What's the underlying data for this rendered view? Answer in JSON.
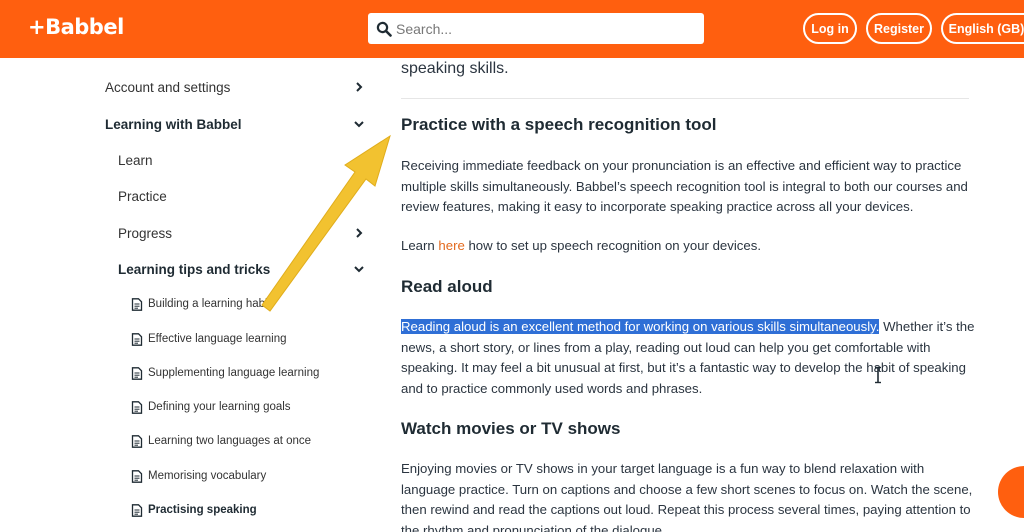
{
  "header": {
    "logo": "+Babbel",
    "search_placeholder": "Search...",
    "login_label": "Log in",
    "register_label": "Register",
    "language_label": "English (GB)"
  },
  "sidebar": {
    "items": [
      {
        "label": "Account and settings",
        "chevron": "right"
      },
      {
        "label": "Learning with Babbel",
        "chevron": "down"
      },
      {
        "label": "Learn",
        "chevron": ""
      },
      {
        "label": "Practice",
        "chevron": ""
      },
      {
        "label": "Progress",
        "chevron": "right"
      },
      {
        "label": "Learning tips and tricks",
        "chevron": "down"
      }
    ],
    "subitems": [
      "Building a learning habit",
      "Effective language learning",
      "Supplementing language learning",
      "Defining your learning goals",
      "Learning two languages at once",
      "Memorising vocabulary",
      "Practising speaking"
    ]
  },
  "content": {
    "intro_fragment": "speaking skills.",
    "sections": [
      {
        "heading": "Practice with a speech recognition tool",
        "paragraph": "Receiving immediate feedback on your pronunciation is an effective and efficient way to practice multiple skills simultaneously. Babbel’s speech recognition tool is integral to both our courses and review features, making it easy to incorporate speaking practice across all your devices.",
        "learn_prefix": "Learn ",
        "learn_link": "here",
        "learn_suffix": " how to set up speech recognition on your devices."
      },
      {
        "heading": "Read aloud",
        "highlighted": "Reading aloud is an excellent method for working on various skills simultaneously.",
        "paragraph": " Whether it’s the news, a short story, or lines from a play, reading out loud can help you get comfortable with speaking. It may feel a bit unusual at first, but it’s a fantastic way to develop the habit of speaking and to practice commonly used words and phrases."
      },
      {
        "heading": "Watch movies or TV shows",
        "paragraph": "Enjoying movies or TV shows in your target language is a fun way to blend relaxation with language practice. Turn on captions and choose a few short scenes to focus on. Watch the scene, then rewind and read the captions out loud. Repeat this process several times, paying attention to the rhythm and pronunciation of the dialogue."
      }
    ]
  },
  "colors": {
    "brand": "#ff5f0f",
    "highlight": "#2f6fd6",
    "link": "#e36a1e",
    "annotation_arrow": "#f2c230"
  },
  "icons": [
    "search-icon",
    "chevron-right-icon",
    "chevron-down-icon",
    "document-icon",
    "chat-icon",
    "text-cursor-icon",
    "annotation-arrow"
  ]
}
